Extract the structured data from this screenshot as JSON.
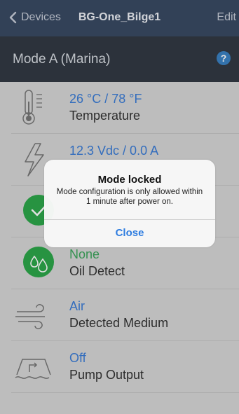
{
  "nav": {
    "back_label": "Devices",
    "title": "BG-One_Bilge1",
    "edit_label": "Edit"
  },
  "mode": {
    "title": "Mode A (Marina)",
    "help_symbol": "?"
  },
  "rows": [
    {
      "value": "26 °C / 78 °F",
      "label": "Temperature",
      "icon": "thermometer-icon",
      "value_color": "#3b7dd8"
    },
    {
      "value": "12.3 Vdc / 0.0 A",
      "label": "",
      "icon": "lightning-icon",
      "value_color": "#3b7dd8"
    },
    {
      "value": "",
      "label": "",
      "icon": "check-circle-icon",
      "value_color": "#3ca55c"
    },
    {
      "value": "None",
      "label": "Oil Detect",
      "icon": "oil-drops-icon",
      "value_color": "#3ca55c"
    },
    {
      "value": "Air",
      "label": "Detected Medium",
      "icon": "wind-icon",
      "value_color": "#3b7dd8"
    },
    {
      "value": "Off",
      "label": "Pump Output",
      "icon": "pump-icon",
      "value_color": "#3b7dd8"
    }
  ],
  "modal": {
    "title": "Mode locked",
    "message": "Mode configuration is only allowed within 1 minute after power on.",
    "close_label": "Close"
  },
  "colors": {
    "nav_bg": "#3a4a64",
    "mode_bg": "#333a44",
    "accent_blue": "#3b7dd8",
    "accent_green": "#2da84a"
  }
}
